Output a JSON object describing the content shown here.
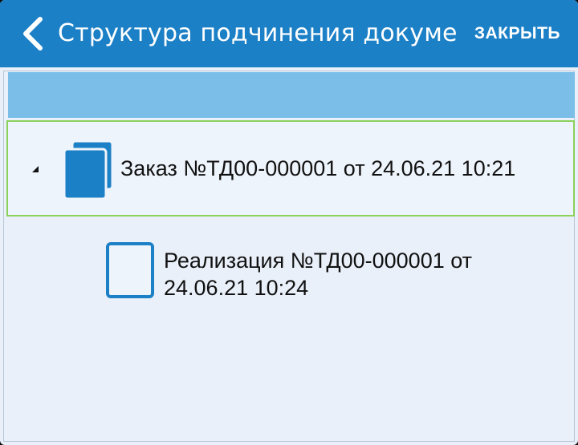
{
  "appbar": {
    "title": "Структура подчинения докумен...",
    "close_label": "ЗАКРЫТЬ",
    "back_icon": "chevron-left-icon",
    "background_color": "#1c80c7"
  },
  "tree": {
    "header_band_color": "#7bbfe8",
    "selected_border_color": "#8bd15a",
    "items": [
      {
        "label": "Заказ №ТД00-000001 от 24.06.21 10:21",
        "icon": "documents-stack-icon",
        "expanded": true,
        "selected": true
      },
      {
        "label": "Реализация №ТД00-000001 от 24.06.21 10:24",
        "icon": "document-outline-icon",
        "expanded": false,
        "selected": false
      }
    ]
  }
}
